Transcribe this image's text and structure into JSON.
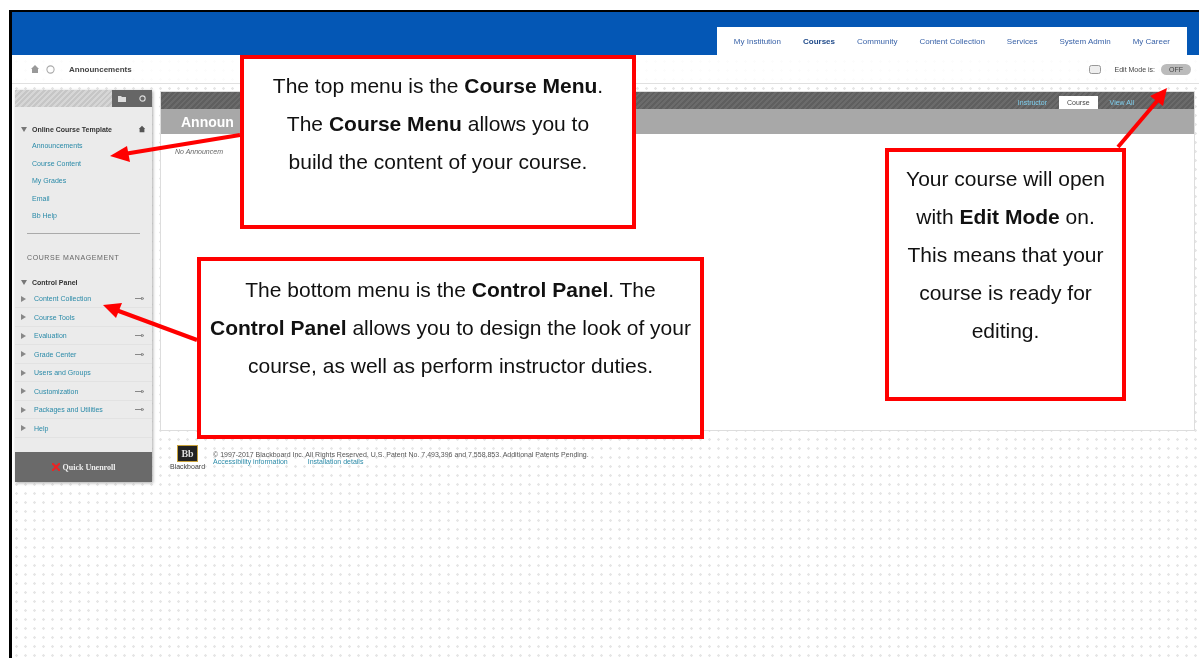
{
  "header": {
    "tabs": [
      {
        "label": "My Institution",
        "selected": false
      },
      {
        "label": "Courses",
        "selected": true
      },
      {
        "label": "Community",
        "selected": false
      },
      {
        "label": "Content Collection",
        "selected": false
      },
      {
        "label": "Services",
        "selected": false
      },
      {
        "label": "System Admin",
        "selected": false
      },
      {
        "label": "My Career",
        "selected": false
      }
    ]
  },
  "breadcrumb": {
    "title": "Announcements"
  },
  "edit_mode": {
    "label": "Edit Mode is:",
    "toggle": "OFF",
    "on": false
  },
  "sidebar": {
    "course_title": "Online Course Template",
    "course_menu": [
      "Announcements",
      "Course Content",
      "My Grades",
      "Email",
      "Bb Help"
    ],
    "section": "COURSE MANAGEMENT",
    "control_panel": {
      "label": "Control Panel",
      "expanded": true,
      "children": [
        {
          "label": "Content Collection",
          "has_menu": true
        },
        {
          "label": "Course Tools",
          "has_menu": false
        },
        {
          "label": "Evaluation",
          "has_menu": true
        },
        {
          "label": "Grade Center",
          "has_menu": true
        },
        {
          "label": "Users and Groups",
          "has_menu": false
        },
        {
          "label": "Customization",
          "has_menu": true
        },
        {
          "label": "Packages and Utilities",
          "has_menu": true
        },
        {
          "label": "Help",
          "has_menu": false
        }
      ]
    },
    "button": "Quick Unenroll"
  },
  "content": {
    "view_tabs": [
      {
        "label": "Instructor",
        "selected": false
      },
      {
        "label": "Course",
        "selected": true
      },
      {
        "label": "View All",
        "selected": false
      }
    ],
    "title": "Announ",
    "empty_text": "No Announcem"
  },
  "footer": {
    "copyright": "© 1997-2017 Blackboard Inc. All Rights Reserved. U.S. Patent No. 7,493,396 and 7,558,853. Additional Patents Pending.",
    "logo": "Bb",
    "logo_caption": "Blackboard",
    "links": [
      "Accessibility information",
      "Installation details"
    ]
  },
  "callouts": [
    {
      "text": "The top menu is the **Course Menu**. The **Course Menu** allows you to build the content of your course."
    },
    {
      "text": "The bottom menu is the **Control Panel**. The **Control Panel** allows you to design the look of your course, as well as perform instructor duties."
    },
    {
      "text": "Your course will open with **Edit Mode** on. This means that your course is ready for editing."
    }
  ]
}
